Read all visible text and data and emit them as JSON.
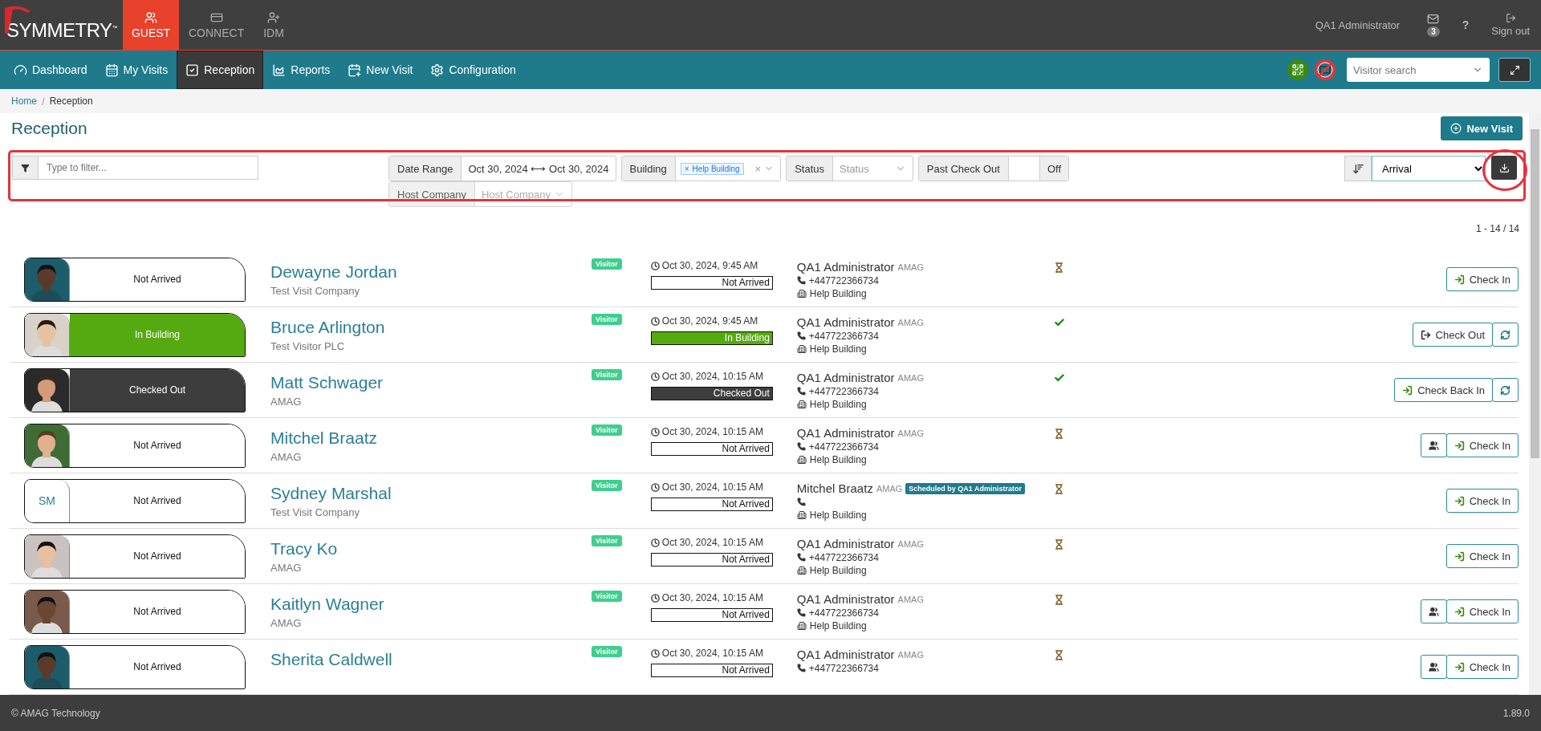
{
  "brand": {
    "name": "SYMMETRY",
    "mark": "™"
  },
  "modules": [
    {
      "label": "GUEST",
      "selected": true
    },
    {
      "label": "CONNECT",
      "selected": false
    },
    {
      "label": "IDM",
      "selected": false
    }
  ],
  "user": {
    "name": "QA1 Administrator",
    "messages": "3",
    "help": "?",
    "sign_out": "Sign out"
  },
  "nav": [
    {
      "label": "Dashboard",
      "selected": false
    },
    {
      "label": "My Visits",
      "selected": false
    },
    {
      "label": "Reception",
      "selected": true
    },
    {
      "label": "Reports",
      "selected": false
    },
    {
      "label": "New Visit",
      "selected": false
    },
    {
      "label": "Configuration",
      "selected": false
    }
  ],
  "visitor_search": {
    "placeholder": "Visitor search"
  },
  "breadcrumb": {
    "items": [
      "Home",
      "Reception"
    ],
    "separator": "/"
  },
  "title": "Reception",
  "new_visit_button": "New Visit",
  "filter": {
    "placeholder": "Type to filter...",
    "date_range": {
      "label": "Date Range",
      "value": "Oct 30, 2024 ⟷ Oct 30, 2024"
    },
    "building": {
      "label": "Building",
      "tag": "Help Building",
      "remove": "×",
      "clear": "×"
    },
    "status": {
      "label": "Status",
      "placeholder": "Status"
    },
    "past_check_out": {
      "label": "Past Check Out",
      "state": "Off"
    },
    "host_company": {
      "label": "Host Company",
      "placeholder": "Host Company"
    },
    "sort": {
      "value": "Arrival"
    }
  },
  "count": "1 - 14 / 14",
  "rows": [
    {
      "avatar": {
        "kind": "picture"
      },
      "status": {
        "kind": "not_arrived",
        "label": "Not Arrived"
      },
      "name": "Dewayne Jordan",
      "company": "Test Visit Company",
      "badge": "Visitor",
      "time": "Oct 30, 2024, 9:45 AM",
      "status_bar": "Not Arrived",
      "host": {
        "name": "QA1 Administrator",
        "company": "AMAG",
        "phone": "+447722366734",
        "building": "Help Building"
      },
      "indicator": {
        "kind": "hourglass"
      },
      "actions": [
        {
          "kind": "check_in",
          "label": "Check In"
        }
      ]
    },
    {
      "avatar": {
        "kind": "picture"
      },
      "status": {
        "kind": "in_building",
        "label": "In Building"
      },
      "name": "Bruce Arlington",
      "company": "Test Visitor PLC",
      "badge": "Visitor",
      "time": "Oct 30, 2024, 9:45 AM",
      "status_bar": "In Building",
      "host": {
        "name": "QA1 Administrator",
        "company": "AMAG",
        "phone": "+447722366734",
        "building": "Help Building"
      },
      "indicator": {
        "kind": "check"
      },
      "actions": [
        {
          "kind": "check_out",
          "label": "Check Out"
        },
        {
          "kind": "refresh"
        }
      ]
    },
    {
      "avatar": {
        "kind": "picture"
      },
      "status": {
        "kind": "checked_out",
        "label": "Checked Out"
      },
      "name": "Matt Schwager",
      "company": "AMAG",
      "badge": "Visitor",
      "time": "Oct 30, 2024, 10:15 AM",
      "status_bar": "Checked Out",
      "host": {
        "name": "QA1 Administrator",
        "company": "AMAG",
        "phone": "+447722366734",
        "building": "Help Building"
      },
      "indicator": {
        "kind": "check"
      },
      "actions": [
        {
          "kind": "check_in",
          "label": "Check Back In"
        },
        {
          "kind": "refresh"
        }
      ]
    },
    {
      "avatar": {
        "kind": "picture"
      },
      "status": {
        "kind": "not_arrived",
        "label": "Not Arrived"
      },
      "name": "Mitchel Braatz",
      "company": "AMAG",
      "badge": "Visitor",
      "time": "Oct 30, 2024, 10:15 AM",
      "status_bar": "Not Arrived",
      "host": {
        "name": "QA1 Administrator",
        "company": "AMAG",
        "phone": "+447722366734",
        "building": "Help Building"
      },
      "indicator": {
        "kind": "hourglass"
      },
      "actions": [
        {
          "kind": "group"
        },
        {
          "kind": "check_in",
          "label": "Check In"
        }
      ]
    },
    {
      "avatar": {
        "kind": "initials",
        "text": "SM"
      },
      "status": {
        "kind": "not_arrived",
        "label": "Not Arrived"
      },
      "name": "Sydney Marshal",
      "company": "Test Visit Company",
      "badge": "Visitor",
      "time": "Oct 30, 2024, 10:15 AM",
      "status_bar": "Not Arrived",
      "host": {
        "name": "Mitchel Braatz",
        "company": "AMAG",
        "scheduled": "Scheduled by QA1 Administrator",
        "building": "Help Building"
      },
      "indicator": {
        "kind": "hourglass"
      },
      "actions": [
        {
          "kind": "check_in",
          "label": "Check In"
        }
      ]
    },
    {
      "avatar": {
        "kind": "picture"
      },
      "status": {
        "kind": "not_arrived",
        "label": "Not Arrived"
      },
      "name": "Tracy Ko",
      "company": "AMAG",
      "badge": "Visitor",
      "time": "Oct 30, 2024, 10:15 AM",
      "status_bar": "Not Arrived",
      "host": {
        "name": "QA1 Administrator",
        "company": "AMAG",
        "phone": "+447722366734",
        "building": "Help Building"
      },
      "indicator": {
        "kind": "hourglass"
      },
      "actions": [
        {
          "kind": "check_in",
          "label": "Check In"
        }
      ]
    },
    {
      "avatar": {
        "kind": "picture"
      },
      "status": {
        "kind": "not_arrived",
        "label": "Not Arrived"
      },
      "name": "Kaitlyn Wagner",
      "company": "AMAG",
      "badge": "Visitor",
      "time": "Oct 30, 2024, 10:15 AM",
      "status_bar": "Not Arrived",
      "host": {
        "name": "QA1 Administrator",
        "company": "AMAG",
        "phone": "+447722366734",
        "building": "Help Building"
      },
      "indicator": {
        "kind": "hourglass"
      },
      "actions": [
        {
          "kind": "group"
        },
        {
          "kind": "check_in",
          "label": "Check In"
        }
      ]
    },
    {
      "avatar": {
        "kind": "picture"
      },
      "status": {
        "kind": "not_arrived",
        "label": "Not Arrived"
      },
      "name": "Sherita Caldwell",
      "badge": "Visitor",
      "time": "Oct 30, 2024, 10:15 AM",
      "status_bar": "Not Arrived",
      "host": {
        "name": "QA1 Administrator",
        "company": "AMAG",
        "phone": "+447722366734"
      },
      "indicator": {
        "kind": "hourglass"
      },
      "actions": [
        {
          "kind": "group"
        },
        {
          "kind": "check_in",
          "label": "Check In"
        }
      ]
    }
  ],
  "footer": {
    "copyright": "© AMAG Technology",
    "version": "1.89.0"
  }
}
